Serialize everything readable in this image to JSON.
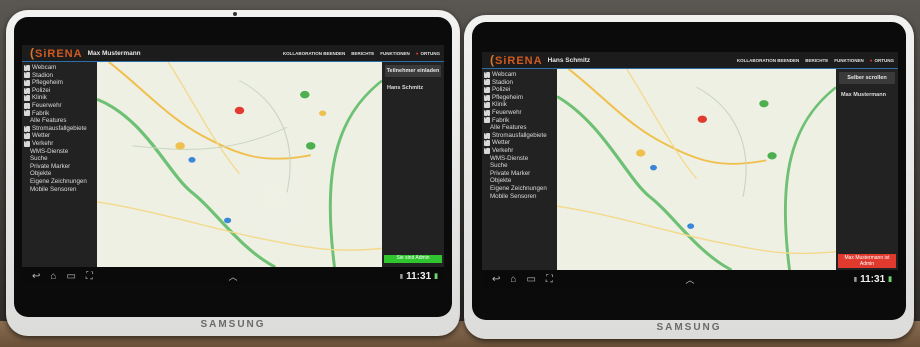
{
  "left": {
    "app": {
      "logo": "SiRENA",
      "user": "Max Mustermann"
    },
    "menu": [
      "KOLLABORATION BEENDEN",
      "BERICHTE",
      "FUNKTIONEN",
      "ORTUNG"
    ],
    "layers": [
      {
        "label": "Webcam",
        "checked": true
      },
      {
        "label": "Stadion",
        "checked": true
      },
      {
        "label": "Pflegeheim",
        "checked": true
      },
      {
        "label": "Polizei",
        "checked": true
      },
      {
        "label": "Klinik",
        "checked": true
      },
      {
        "label": "Feuerwehr",
        "checked": false
      },
      {
        "label": "Fabrik",
        "checked": true
      }
    ],
    "layers_2": [
      {
        "label": "Stromausfallgebiete",
        "checked": true
      },
      {
        "label": "Wetter",
        "checked": true
      },
      {
        "label": "Verkehr",
        "checked": true
      }
    ],
    "features_all": "Alle Features",
    "tools": [
      "WMS-Dienste",
      "Suche",
      "Private Marker",
      "Objekte",
      "Eigene Zeichnungen",
      "Mobile Sensoren"
    ],
    "right_button": "Teilnehmer einladen",
    "participant": "Hans Schmitz",
    "status": "Sie sind Admin",
    "status_color": "#2fc52f",
    "clock": "11:31"
  },
  "right": {
    "app": {
      "logo": "SiRENA",
      "user": "Hans Schmitz"
    },
    "menu": [
      "KOLLABORATION BEENDEN",
      "BERICHTE",
      "FUNKTIONEN",
      "ORTUNG"
    ],
    "layers": [
      {
        "label": "Webcam",
        "checked": true
      },
      {
        "label": "Stadion",
        "checked": true
      },
      {
        "label": "Polizei",
        "checked": true
      },
      {
        "label": "Pflegeheim",
        "checked": true
      },
      {
        "label": "Klinik",
        "checked": true
      },
      {
        "label": "Feuerwehr",
        "checked": true
      },
      {
        "label": "Fabrik",
        "checked": true
      }
    ],
    "features_all": "Alle Features",
    "layers_2": [
      {
        "label": "Stromausfallgebiete",
        "checked": true
      },
      {
        "label": "Wetter",
        "checked": true
      },
      {
        "label": "Verkehr",
        "checked": true
      }
    ],
    "tools": [
      "WMS-Dienste",
      "Suche",
      "Private Marker",
      "Objekte",
      "Eigene Zeichnungen",
      "Mobile Sensoren"
    ],
    "right_button": "Selber scrollen",
    "participant": "Max Mustermann",
    "status": "Max Mustermann ist Admin",
    "status_color": "#e03a2e",
    "clock": "11:31"
  },
  "brand": "SAMSUNG",
  "icons": [
    "back-icon",
    "home-icon",
    "recent-apps-icon",
    "screenshot-icon",
    "caret-up-icon",
    "battery-icon",
    "signal-icon",
    "help-dot-icon"
  ]
}
